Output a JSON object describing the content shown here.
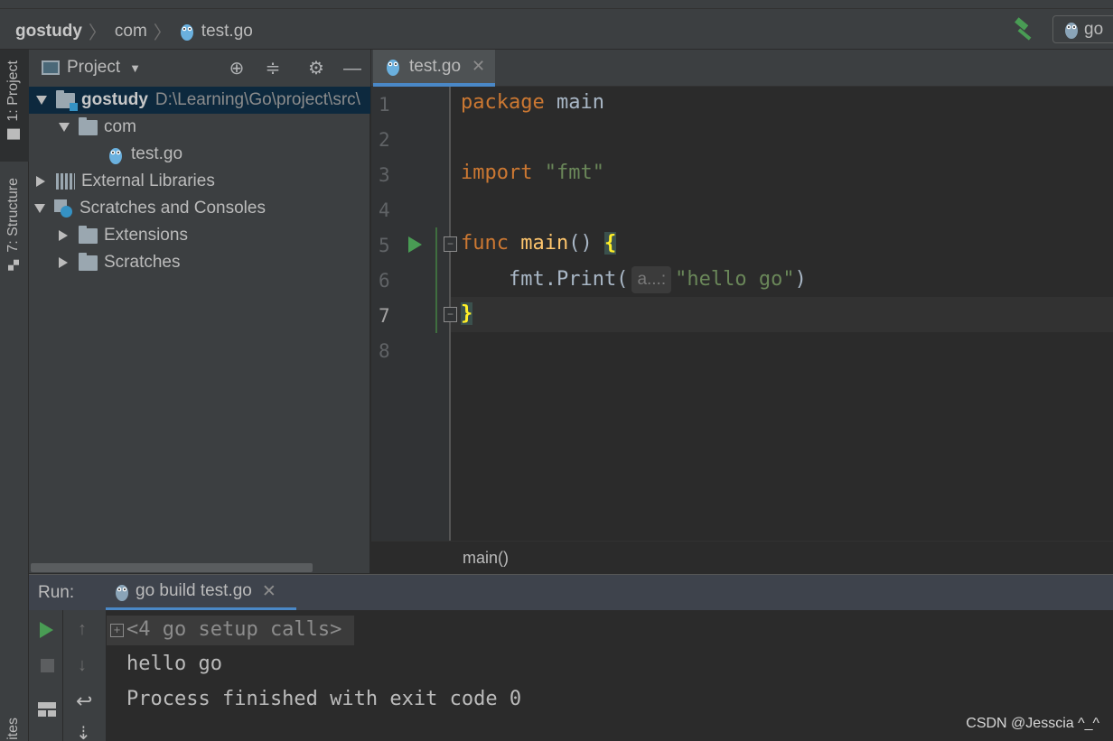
{
  "breadcrumb": {
    "project": "gostudy",
    "folder": "com",
    "file": "test.go"
  },
  "run_config": {
    "label": "go"
  },
  "tool_strip": {
    "project_tab": "1: Project",
    "structure_tab": "7: Structure",
    "favorites_tab": "ites"
  },
  "project_panel": {
    "title": "Project",
    "tree": [
      {
        "label": "gostudy",
        "path": "D:\\Learning\\Go\\project\\src\\"
      },
      {
        "label": "com"
      },
      {
        "label": "test.go"
      },
      {
        "label": "External Libraries"
      },
      {
        "label": "Scratches and Consoles"
      },
      {
        "label": "Extensions"
      },
      {
        "label": "Scratches"
      }
    ]
  },
  "editor": {
    "tab_label": "test.go",
    "line_numbers": [
      "1",
      "2",
      "3",
      "4",
      "5",
      "6",
      "7",
      "8"
    ],
    "code": {
      "l1_kw": "package",
      "l1_name": " main",
      "l3_kw": "import",
      "l3_str": " \"fmt\"",
      "l5_kw": "func",
      "l5_fn": " main",
      "l5_parens": "() ",
      "l5_brace": "{",
      "l6_pre": "    fmt.Print(",
      "l6_hint": "a...:",
      "l6_str": "\"hello go\"",
      "l6_post": ")",
      "l7_brace": "}"
    },
    "breadcrumb_func": "main()"
  },
  "run_panel": {
    "label": "Run:",
    "tab_label": "go build test.go",
    "setup_calls": "<4 go setup calls>",
    "output": [
      "hello go",
      "Process finished with exit code 0"
    ]
  },
  "watermark": "CSDN @Jesscia ^_^",
  "colors": {
    "keyword": "#cc7832",
    "function": "#ffc66d",
    "string": "#6a8759",
    "selection": "#0d293e",
    "accent": "#4a88c7",
    "run": "#499c54"
  }
}
